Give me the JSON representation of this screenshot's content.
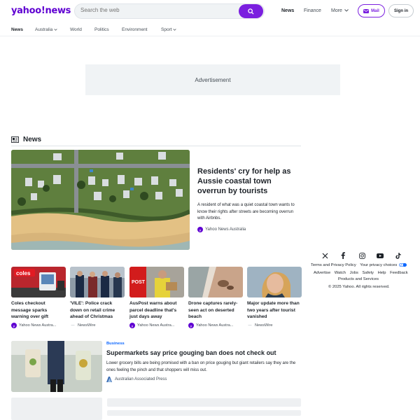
{
  "header": {
    "logo": "yahoo!news",
    "search_placeholder": "Search the web",
    "nav": [
      "News",
      "Finance",
      "More"
    ],
    "mail_label": "Mail",
    "signin_label": "Sign in"
  },
  "subnav": [
    "News",
    "Australia",
    "World",
    "Politics",
    "Environment",
    "Sport"
  ],
  "ad_label": "Advertisement",
  "section_title": "News",
  "hero": {
    "title": "Residents' cry for help as Aussie coastal town overrun by tourists",
    "description": "A resident of what was a quiet coastal town wants to know their rights after streets are becoming overrun with Airbnbs.",
    "source": "Yahoo News Australia"
  },
  "cards": [
    {
      "title": "Coles checkout message sparks warning over gift",
      "source": "Yahoo News Austra..."
    },
    {
      "title": "'VILE': Police crack down on retail crime ahead of Christmas",
      "source": "NewsWire"
    },
    {
      "title": "AusPost warns about parcel deadline that's just days away",
      "source": "Yahoo News Austra..."
    },
    {
      "title": "Drone captures rarely-seen act on deserted beach",
      "source": "Yahoo News Austra..."
    },
    {
      "title": "Major update more than two years after tourist vanished",
      "source": "NewsWire"
    }
  ],
  "card_img_text": {
    "coles": "coles",
    "post": "POST"
  },
  "article": {
    "category": "Business",
    "title": "Supermarkets say price gouging ban does not check out",
    "description": "Lower grocery bills are being promised with a ban on price gouging but giant retailers say they are the ones feeling the pinch and that shoppers will miss out.",
    "source": "Australian Associated Press"
  },
  "footer": {
    "row1": [
      "Terms and Privacy Policy",
      "Your privacy choices"
    ],
    "row2": [
      "Advertise",
      "Watch",
      "Jobs",
      "Safety",
      "Help",
      "Feedback"
    ],
    "row3": "Products and Services",
    "copyright": "© 2025 Yahoo. All rights reserved."
  },
  "colors": {
    "brand": "#6001d2",
    "accent": "#7b1fdf",
    "link": "#0f69ff"
  }
}
